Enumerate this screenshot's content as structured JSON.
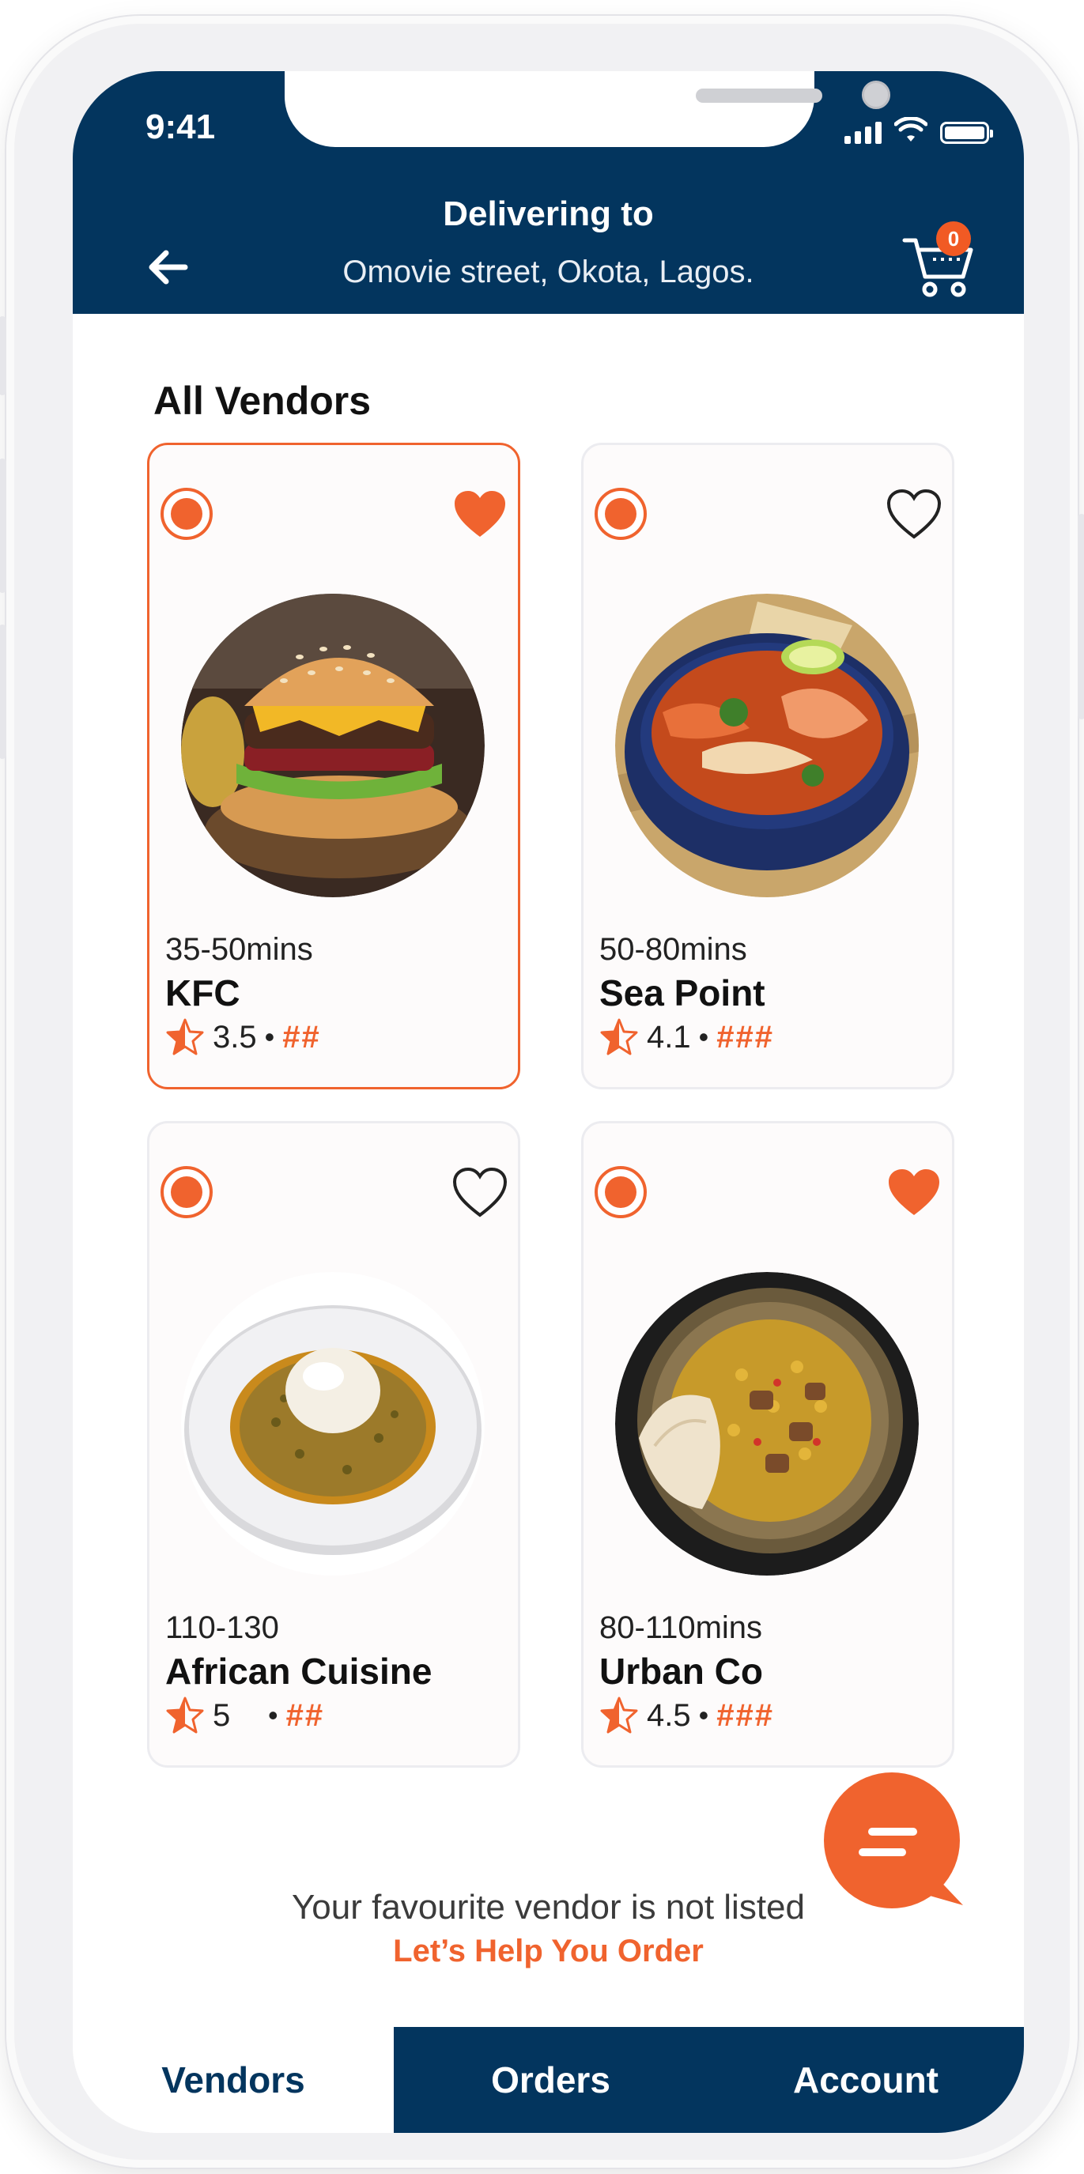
{
  "status_bar": {
    "time": "9:41"
  },
  "header": {
    "title": "Delivering to",
    "address": "Omovie street, Okota, Lagos.",
    "cart_count": "0"
  },
  "section_title": "All Vendors",
  "vendors": [
    {
      "eta": "35-50mins",
      "name": "KFC",
      "rating": "3.5",
      "price": "##",
      "favourite": true,
      "selected": true
    },
    {
      "eta": "50-80mins",
      "name": "Sea Point",
      "rating": "4.1",
      "price": "###",
      "favourite": false,
      "selected": false
    },
    {
      "eta": "110-130",
      "name": "African Cuisine",
      "rating": "5",
      "price": "##",
      "favourite": false,
      "selected": false
    },
    {
      "eta": "80-110mins",
      "name": "Urban Co",
      "rating": "4.5",
      "price": "###",
      "favourite": true,
      "selected": false
    }
  ],
  "meta_separator": "•",
  "footer": {
    "note": "Your favourite vendor is not listed",
    "help_link": "Let’s Help You Order"
  },
  "tabs": [
    {
      "label": "Vendors",
      "active": true
    },
    {
      "label": "Orders",
      "active": false
    },
    {
      "label": "Account",
      "active": false
    }
  ],
  "colors": {
    "primary": "#03355e",
    "accent": "#f0632e",
    "card_bg": "#fdfbfb"
  },
  "icons": {
    "back": "arrow-left-icon",
    "cart": "cart-icon",
    "heart": "heart-icon",
    "star": "star-icon",
    "chat": "chat-icon"
  }
}
